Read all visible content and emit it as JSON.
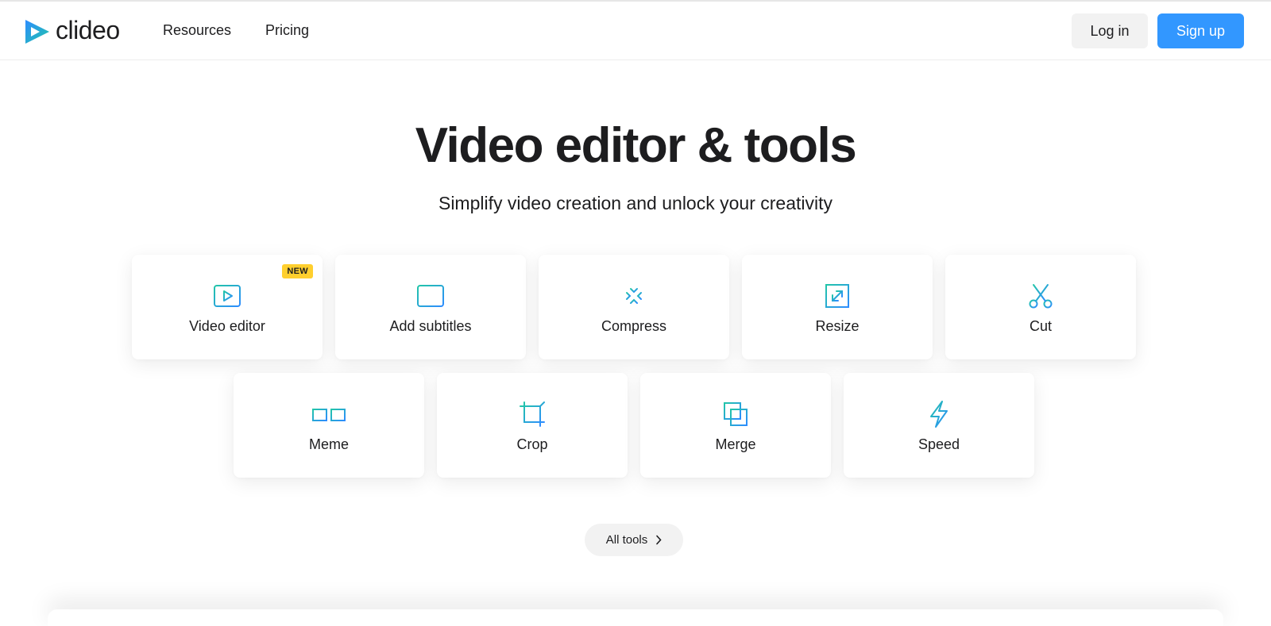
{
  "brand": {
    "name": "clideo",
    "logo_icon": "play-triangle-logo-icon",
    "colors": {
      "logo_blue": "#2d8cff",
      "logo_teal": "#22c5a9"
    }
  },
  "nav": {
    "links": [
      {
        "label": "Resources"
      },
      {
        "label": "Pricing"
      }
    ],
    "login_label": "Log in",
    "signup_label": "Sign up"
  },
  "hero": {
    "title": "Video editor & tools",
    "subtitle": "Simplify video creation and unlock your creativity"
  },
  "tools": [
    {
      "label": "Video editor",
      "icon": "video-editor-icon",
      "badge": "NEW"
    },
    {
      "label": "Add subtitles",
      "icon": "subtitles-icon"
    },
    {
      "label": "Compress",
      "icon": "compress-icon"
    },
    {
      "label": "Resize",
      "icon": "resize-icon"
    },
    {
      "label": "Cut",
      "icon": "scissors-icon"
    },
    {
      "label": "Meme",
      "icon": "meme-glasses-icon"
    },
    {
      "label": "Crop",
      "icon": "crop-icon"
    },
    {
      "label": "Merge",
      "icon": "merge-icon"
    },
    {
      "label": "Speed",
      "icon": "lightning-icon"
    }
  ],
  "all_tools_label": "All tools",
  "colors": {
    "signup_bg": "#3297ff",
    "badge_bg": "#ffcf2e",
    "icon_gradient_start": "#22c5a9",
    "icon_gradient_end": "#2d8cff"
  }
}
